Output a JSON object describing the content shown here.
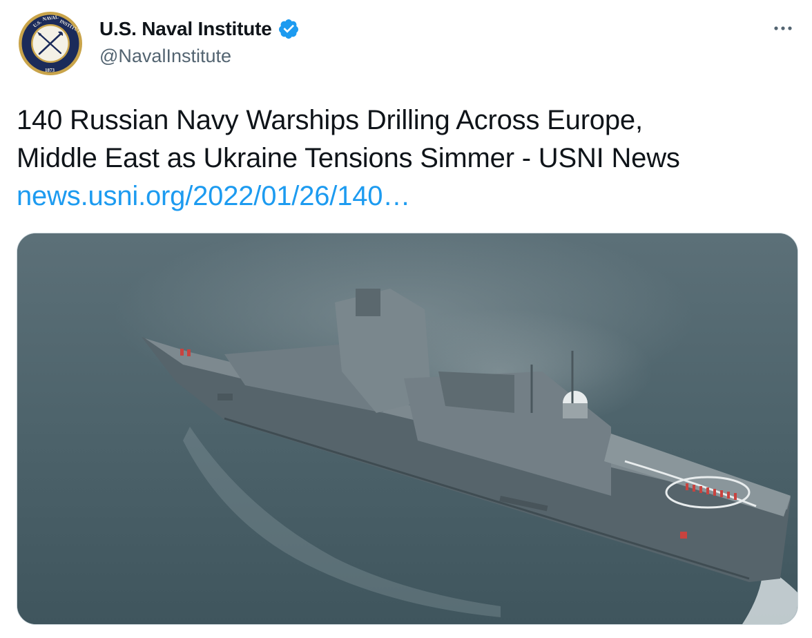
{
  "tweet": {
    "author": {
      "display_name": "U.S. Naval Institute",
      "handle": "@NavalInstitute",
      "verified": true,
      "avatar_icon": "naval-institute-seal",
      "avatar_text_top": "U.S. NAVAL INSTITUTE",
      "avatar_year": "1873"
    },
    "text_lines": [
      "140 Russian Navy Warships Drilling Across Europe,",
      "Middle East as Ukraine Tensions Simmer - USNI News"
    ],
    "link": "news.usni.org/2022/01/26/140…",
    "more_icon": "more-horizontal-icon",
    "media": {
      "type": "photo",
      "subject": "grey-frigate-at-sea"
    }
  },
  "colors": {
    "text": "#0f1419",
    "secondary": "#536471",
    "link": "#1d9bf0",
    "verified": "#1d9bf0",
    "border": "#cfd9de",
    "sea": "#4b626b",
    "ship": "#6b7880",
    "avatar_navy": "#1b2b5a",
    "avatar_gold": "#c9a44a"
  }
}
